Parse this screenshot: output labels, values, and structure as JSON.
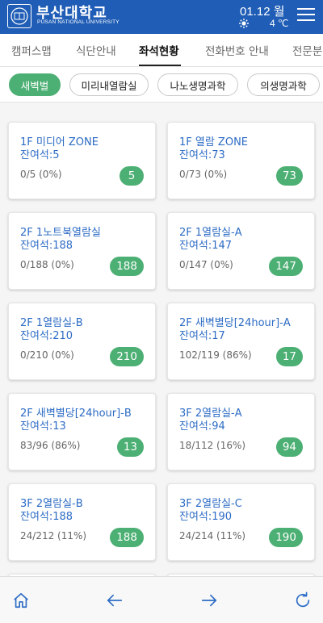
{
  "header": {
    "logo_text": "부산대학교",
    "logo_subtext": "PUSAN NATIONAL UNIVERSITY",
    "date": "01.12 월",
    "temperature": "4 ℃",
    "weather_icon": "sun-icon"
  },
  "tabs": [
    {
      "label": "캠퍼스맵",
      "active": false
    },
    {
      "label": "식단안내",
      "active": false
    },
    {
      "label": "좌석현황",
      "active": true
    },
    {
      "label": "전화번호 안내",
      "active": false
    },
    {
      "label": "전문분",
      "active": false
    }
  ],
  "libraries": [
    {
      "label": "새벽벌",
      "active": true
    },
    {
      "label": "미리내열람실",
      "active": false
    },
    {
      "label": "나노생명과학",
      "active": false
    },
    {
      "label": "의생명과학",
      "active": false
    }
  ],
  "rooms": [
    {
      "name": "1F 미디어 ZONE",
      "remaining_label": "잔여석:5",
      "usage": "0/5 (0%)",
      "badge": "5"
    },
    {
      "name": "1F 열람 ZONE",
      "remaining_label": "잔여석:73",
      "usage": "0/73 (0%)",
      "badge": "73"
    },
    {
      "name": "2F 1노트북열람실",
      "remaining_label": "잔여석:188",
      "usage": "0/188 (0%)",
      "badge": "188"
    },
    {
      "name": "2F 1열람실-A",
      "remaining_label": "잔여석:147",
      "usage": "0/147 (0%)",
      "badge": "147"
    },
    {
      "name": "2F 1열람실-B",
      "remaining_label": "잔여석:210",
      "usage": "0/210 (0%)",
      "badge": "210"
    },
    {
      "name": "2F 새벽별당[24hour]-A",
      "remaining_label": "잔여석:17",
      "usage": "102/119 (86%)",
      "badge": "17"
    },
    {
      "name": "2F 새벽별당[24hour]-B",
      "remaining_label": "잔여석:13",
      "usage": "83/96 (86%)",
      "badge": "13"
    },
    {
      "name": "3F 2열람실-A",
      "remaining_label": "잔여석:94",
      "usage": "18/112 (16%)",
      "badge": "94"
    },
    {
      "name": "3F 2열람실-B",
      "remaining_label": "잔여석:188",
      "usage": "24/212 (11%)",
      "badge": "188"
    },
    {
      "name": "3F 2열람실-C",
      "remaining_label": "잔여석:190",
      "usage": "24/214 (11%)",
      "badge": "190"
    }
  ],
  "colors": {
    "header_bg": "#1f5db6",
    "accent_green": "#4caf73",
    "room_text": "#2d6cc5",
    "nav_icon": "#2d6cc5"
  },
  "bottom_nav": [
    {
      "icon": "home-icon"
    },
    {
      "icon": "arrow-left-icon"
    },
    {
      "icon": "arrow-right-icon"
    },
    {
      "icon": "refresh-icon"
    }
  ]
}
